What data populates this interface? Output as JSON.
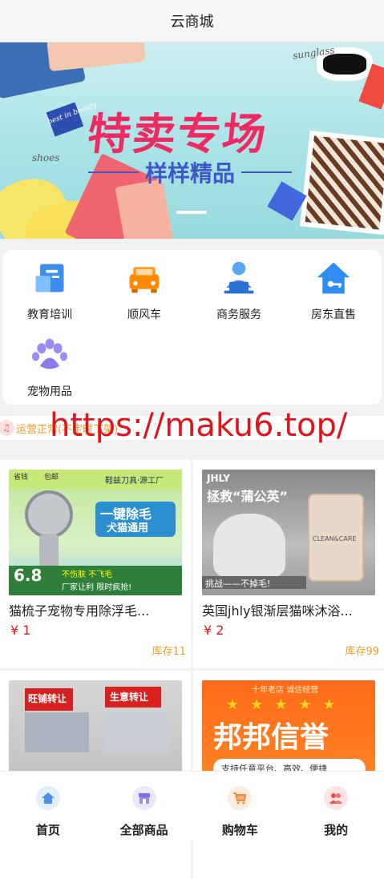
{
  "header": {
    "title": "云商城"
  },
  "banner": {
    "title": "特卖专场",
    "subtitle": "样样精品",
    "script_words": [
      "sunglass",
      "best in beauty",
      "shoes"
    ]
  },
  "categories": [
    {
      "label": "教育培训",
      "icon": "education-icon"
    },
    {
      "label": "顺风车",
      "icon": "car-icon"
    },
    {
      "label": "商务服务",
      "icon": "business-service-icon"
    },
    {
      "label": "房东直售",
      "icon": "house-icon"
    },
    {
      "label": "宠物用品",
      "icon": "pet-paw-icon"
    }
  ],
  "notice": {
    "text": "运营正常(不定时下架)"
  },
  "watermark": "https://maku6.top/",
  "products": [
    {
      "title": "猫梳子宠物专用除浮毛...",
      "price": "¥ 1",
      "stock": "库存11",
      "img_text": [
        "一键除毛",
        "犬猫通用",
        "6.8",
        "不伤肤 不飞毛",
        "厂家让利 限时疯抢!",
        "省钱",
        "包邮",
        "鞋兹刀具·源工厂"
      ]
    },
    {
      "title": "英国jhly银渐层猫咪沐浴...",
      "price": "¥ 2",
      "stock": "库存99",
      "img_text": [
        "JHLY",
        "拯救“蒲公英”",
        "挑战——不掉毛!",
        "CLEAN&CARE"
      ]
    },
    {
      "title": "",
      "price": "",
      "stock": "",
      "img_text": [
        "旺铺转让",
        "生意转让"
      ]
    },
    {
      "title": "",
      "price": "",
      "stock": "",
      "img_text": [
        "十年老店 诚信经营",
        "邦邦信誉",
        "支持任意平台、高效、便捷"
      ]
    }
  ],
  "tabbar": [
    {
      "label": "首页",
      "icon": "home-icon",
      "color": "#4b8ff0"
    },
    {
      "label": "全部商品",
      "icon": "shop-icon",
      "color": "#7d6cf0"
    },
    {
      "label": "购物车",
      "icon": "cart-icon",
      "color": "#f08a3c"
    },
    {
      "label": "我的",
      "icon": "user-icon",
      "color": "#ee4a4a"
    }
  ]
}
